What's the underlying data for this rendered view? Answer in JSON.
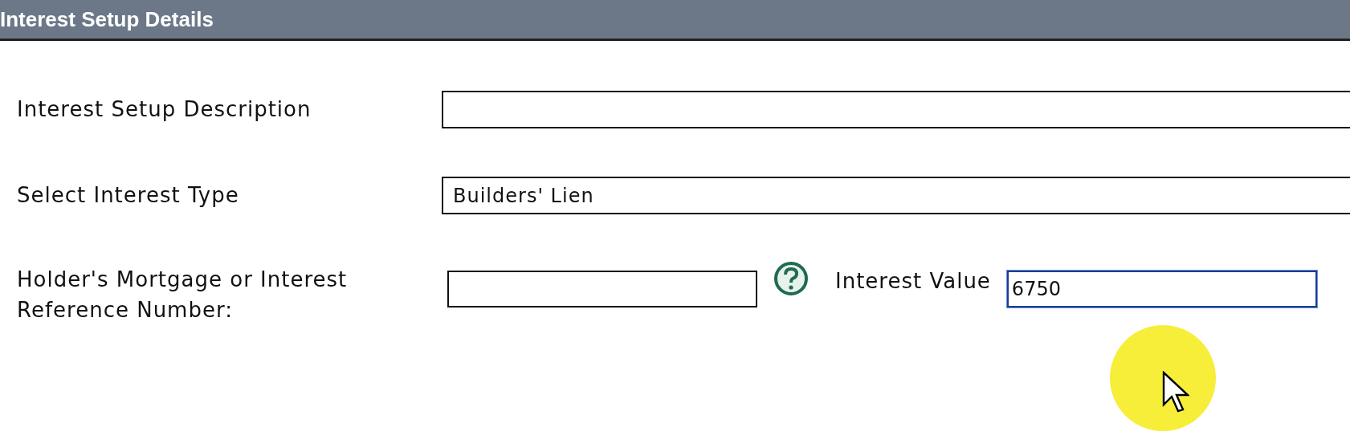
{
  "header": {
    "title": "Interest Setup Details"
  },
  "fields": [
    {
      "label": "Interest Setup Description"
    },
    {
      "label": "Select Interest Type",
      "value": "Builders' Lien"
    }
  ],
  "reference": {
    "label": "Holder's Mortgage or Interest Reference Number:"
  },
  "interest_value": {
    "label": "Interest Value",
    "value": "6750",
    "focused": true
  }
}
